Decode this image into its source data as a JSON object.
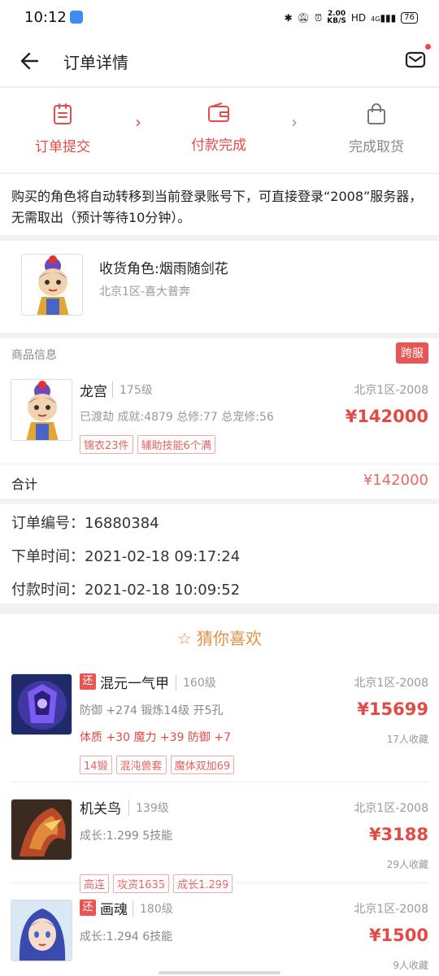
{
  "status_bar": {
    "time": "10:12",
    "net_speed_top": "2.00",
    "net_speed_bottom": "KB/S",
    "hd": "HD",
    "signal": "4G",
    "battery": "76"
  },
  "nav": {
    "title": "订单详情"
  },
  "steps": [
    {
      "label": "订单提交",
      "icon": "clipboard-icon",
      "state": "done"
    },
    {
      "label": "付款完成",
      "icon": "wallet-icon",
      "state": "done"
    },
    {
      "label": "完成取货",
      "icon": "bag-icon",
      "state": "todo"
    }
  ],
  "notice": "购买的角色将自动转移到当前登录账号下，可直接登录“2008”服务器，无需取出（预计等待10分钟）。",
  "receiver": {
    "role": "收货角色:烟雨随剑花",
    "server": "北京1区-喜大普奔"
  },
  "goods": {
    "header": "商品信息",
    "badge": "跨服",
    "name": "龙宫",
    "level": "175级",
    "server": "北京1区-2008",
    "desc": "已渡劫 成就:4879 总修:77 总宠修:56",
    "price": "¥142000",
    "tags": [
      "锦衣23件",
      "辅助技能6个满"
    ],
    "total_label": "合计",
    "total_value": "¥142000"
  },
  "order": {
    "number": "订单编号：16880384",
    "placed": "下单时间：2021-02-18 09:17:24",
    "paid": "付款时间：2021-02-18 10:09:52"
  },
  "recommend": {
    "title": "猜你喜欢",
    "items": [
      {
        "badge": "还",
        "name": "混元一气甲",
        "level": "160级",
        "server": "北京1区-2008",
        "desc": "防御 +274 锻炼14级 开5孔",
        "stats": "体质 +30 魔力 +39 防御 +7",
        "price": "¥15699",
        "fav": "17人收藏",
        "tags": [
          "14锻",
          "混沌兽套",
          "魔体双加69"
        ]
      },
      {
        "badge": "",
        "name": "机关鸟",
        "level": "139级",
        "server": "北京1区-2008",
        "desc": "成长:1.299 5技能",
        "stats": "",
        "price": "¥3188",
        "fav": "29人收藏",
        "tags": [
          "高连",
          "攻资1635",
          "成长1.299"
        ]
      },
      {
        "badge": "还",
        "name": "画魂",
        "level": "180级",
        "server": "北京1区-2008",
        "desc": "成长:1.294 6技能",
        "stats": "",
        "price": "¥1500",
        "fav": "9人收藏",
        "tags": []
      }
    ]
  },
  "colors": {
    "accent": "#e64b4b",
    "price": "#e44a44",
    "rec_title": "#e78e45"
  }
}
